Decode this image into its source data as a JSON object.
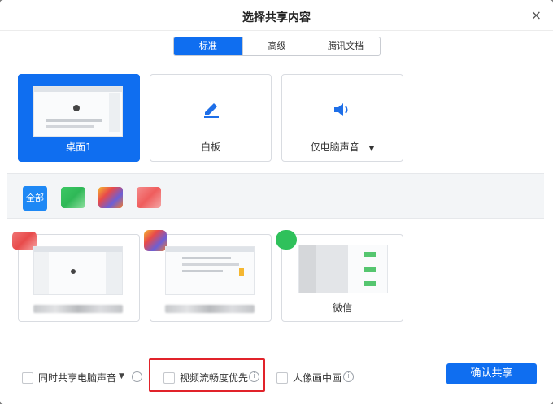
{
  "dialog": {
    "title": "选择共享内容",
    "close": "×"
  },
  "tabs": [
    {
      "label": "标准",
      "active": true
    },
    {
      "label": "高级",
      "active": false
    },
    {
      "label": "腾讯文档",
      "active": false
    }
  ],
  "share_options": [
    {
      "label": "桌面1",
      "selected": true,
      "icon": "desktop-thumbnail"
    },
    {
      "label": "白板",
      "selected": false,
      "icon": "pen-icon"
    },
    {
      "label": "仅电脑声音",
      "selected": false,
      "icon": "speaker-icon",
      "has_dropdown": true
    }
  ],
  "filter": {
    "all_label": "全部"
  },
  "windows": [
    {
      "label": "",
      "app_icon": "app-icon-red"
    },
    {
      "label": "",
      "app_icon": "app-icon-multicolor"
    },
    {
      "label": "微信",
      "app_icon": "wechat-icon"
    }
  ],
  "footer": {
    "share_audio": "同时共享电脑声音",
    "video_priority": "视频流畅度优先",
    "pip": "人像画中画",
    "confirm": "确认共享"
  },
  "colors": {
    "accent": "#0f6ef0",
    "highlight_box": "#e1232a"
  }
}
